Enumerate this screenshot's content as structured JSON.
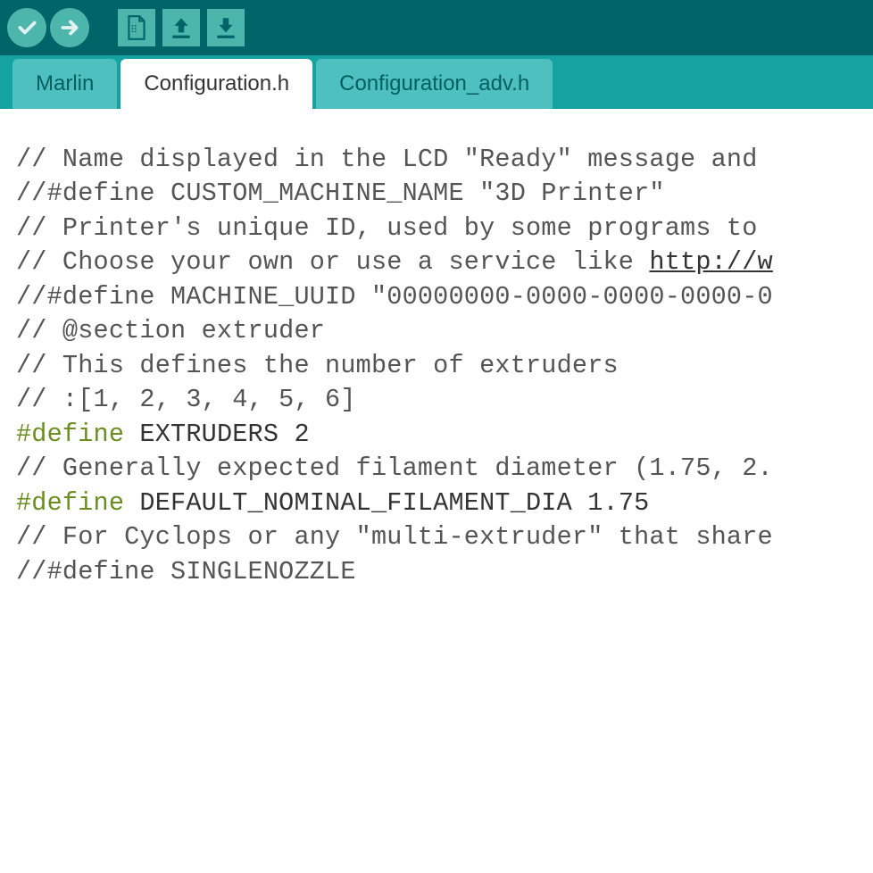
{
  "toolbar": {
    "verify": "verify",
    "upload": "upload",
    "new": "new",
    "open": "open",
    "save": "save"
  },
  "tabs": {
    "t0": "Marlin",
    "t1": "Configuration.h",
    "t2": "Configuration_adv.h"
  },
  "code": {
    "l1": "// Name displayed in the LCD \"Ready\" message and ",
    "l2": "//#define CUSTOM_MACHINE_NAME \"3D Printer\"",
    "l3": "",
    "l4": "// Printer's unique ID, used by some programs to ",
    "l5a": "// Choose your own or use a service like ",
    "l5b": "http://w",
    "l6": "//#define MACHINE_UUID \"00000000-0000-0000-0000-0",
    "l7": "",
    "l8": "// @section extruder",
    "l9": "",
    "l10": "// This defines the number of extruders",
    "l11": "// :[1, 2, 3, 4, 5, 6]",
    "l12a": "#define",
    "l12b": " EXTRUDERS 2",
    "l13": "",
    "l14": "// Generally expected filament diameter (1.75, 2.",
    "l15a": "#define",
    "l15b": " DEFAULT_NOMINAL_FILAMENT_DIA 1.75",
    "l16": "",
    "l17": "// For Cyclops or any \"multi-extruder\" that share",
    "l18": "//#define SINGLENOZZLE"
  }
}
